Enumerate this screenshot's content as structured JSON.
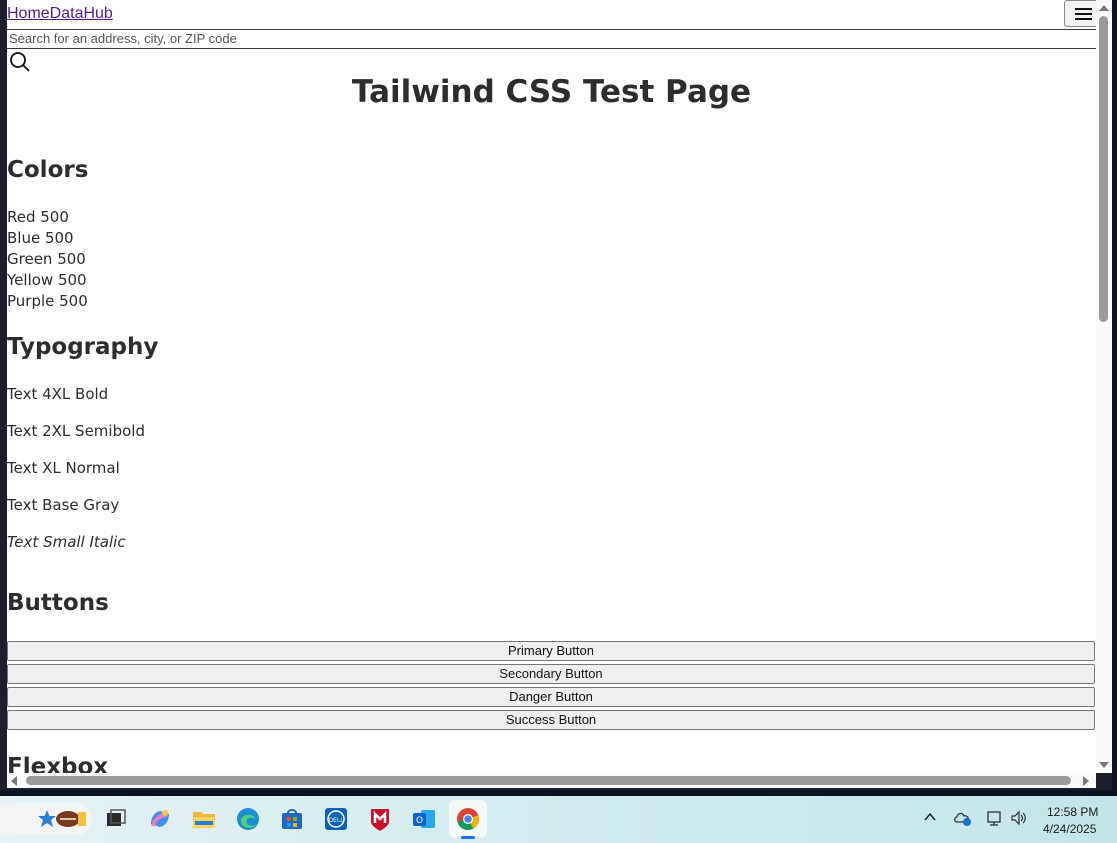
{
  "browser": {
    "nav": {
      "brand": "HomeDataHub",
      "menu_icon": "hamburger-menu-icon"
    },
    "search": {
      "placeholder": "Search for an address, city, or ZIP code",
      "icon": "search-icon"
    }
  },
  "page": {
    "title": "Tailwind CSS Test Page",
    "sections": {
      "colors": {
        "heading": "Colors",
        "items": [
          "Red 500",
          "Blue 500",
          "Green 500",
          "Yellow 500",
          "Purple 500"
        ]
      },
      "typography": {
        "heading": "Typography",
        "items": [
          "Text 4XL Bold",
          "Text 2XL Semibold",
          "Text XL Normal",
          "Text Base Gray",
          "Text Small Italic"
        ]
      },
      "buttons": {
        "heading": "Buttons",
        "items": [
          "Primary Button",
          "Secondary Button",
          "Danger Button",
          "Success Button"
        ]
      },
      "flexbox": {
        "heading": "Flexbox"
      }
    }
  },
  "taskbar": {
    "apps": [
      "search-widget",
      "task-view",
      "copilot",
      "file-explorer",
      "edge",
      "microsoft-store",
      "dell",
      "mcafee",
      "outlook",
      "chrome"
    ],
    "clock": {
      "time": "12:58 PM",
      "date": "4/24/2025"
    }
  }
}
